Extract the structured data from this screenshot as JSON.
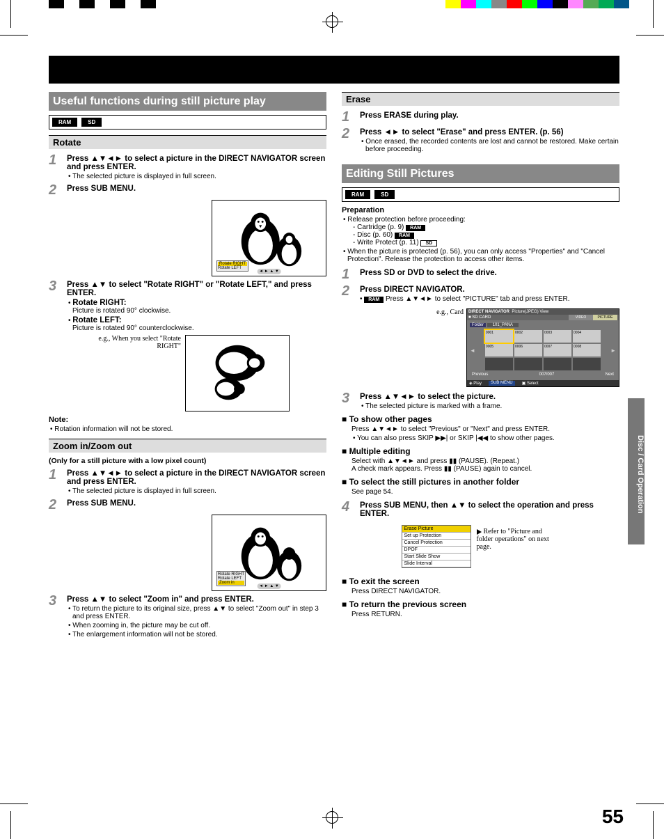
{
  "page_number": "55",
  "side_tab": "Disc / Card Operation",
  "left": {
    "h_main": "Useful functions during still picture play",
    "badges": [
      "RAM",
      "SD"
    ],
    "rotate": {
      "heading": "Rotate",
      "step1": "Press ▲▼◄► to select a picture in the DIRECT NAVIGATOR screen and press ENTER.",
      "step1_note": "The selected picture is displayed in full screen.",
      "step2": "Press SUB MENU.",
      "img_menu": [
        "Rotate RIGHT",
        "Rotate LEFT"
      ],
      "step3": "Press ▲▼ to select \"Rotate RIGHT\" or \"Rotate LEFT,\" and press ENTER.",
      "rr_label": "Rotate RIGHT:",
      "rr_text": "Picture is rotated 90° clockwise.",
      "rl_label": "Rotate LEFT:",
      "rl_text": "Picture is rotated 90° counterclockwise.",
      "eg": "e.g., When you select \"Rotate RIGHT\"",
      "note_hd": "Note:",
      "note_text": "Rotation information will not be stored."
    },
    "zoom": {
      "heading": "Zoom in/Zoom out",
      "pre": "(Only for a still picture with a low pixel count)",
      "step1": "Press ▲▼◄► to select a picture in the DIRECT NAVIGATOR screen and press ENTER.",
      "step1_note": "The selected picture is displayed in full screen.",
      "step2": "Press SUB MENU.",
      "img_menu": [
        "Rotate RIGHT",
        "Rotate LEFT",
        "Zoom in"
      ],
      "step3": "Press ▲▼ to select \"Zoom in\" and press ENTER.",
      "b1": "To return the picture to its original size, press ▲▼ to select \"Zoom out\" in step 3 and press ENTER.",
      "b2": "When zooming in, the picture may be cut off.",
      "b3": "The enlargement information will not be stored."
    }
  },
  "right": {
    "erase": {
      "heading": "Erase",
      "step1": "Press ERASE during play.",
      "step2": "Press ◄► to select \"Erase\" and press ENTER. (p. 56)",
      "note": "Once erased, the recorded contents are lost and cannot be restored. Make certain before proceeding."
    },
    "edit": {
      "h_main": "Editing Still Pictures",
      "badges": [
        "RAM",
        "SD"
      ],
      "prep_hd": "Preparation",
      "prep_b1": "Release protection before proceeding:",
      "prep_items": [
        {
          "text": "Cartridge (p. 9)",
          "badge": "RAM"
        },
        {
          "text": "Disc (p. 60)",
          "badge": "RAM"
        },
        {
          "text": "Write Protect (p. 11)",
          "badge": "SD"
        }
      ],
      "prep_b2": "When the picture is protected (p. 56), you can only access \"Properties\" and \"Cancel Protection\". Release the protection to access other items.",
      "step1": "Press SD or DVD to select the drive.",
      "step2": "Press DIRECT NAVIGATOR.",
      "step2_badge": "RAM",
      "step2_note": "Press ▲▼◄► to select \"PICTURE\" tab and press ENTER.",
      "eg": "e.g., Card",
      "nav": {
        "title": "DIRECT NAVIGATOR",
        "mode": "Picture(JPEG) View",
        "tabs": [
          "VIDEO",
          "PICTURE"
        ],
        "src": "SD CARD",
        "folder_label": "Folder",
        "folder": "101_PANA",
        "cells": [
          "0001",
          "0002",
          "0003",
          "0004",
          "0005",
          "0006",
          "0007",
          "0008"
        ],
        "prev": "Previous",
        "page": "007/007",
        "next": "Next",
        "foot1": "Play",
        "foot2": "SUB MENU",
        "foot3": "Select"
      },
      "step3": "Press ▲▼◄► to select the picture.",
      "step3_note": "The selected picture is marked with a frame.",
      "sec_pages": "To show other pages",
      "sec_pages_b1": "Press ▲▼◄► to select \"Previous\" or \"Next\" and press ENTER.",
      "sec_pages_b2": "You can also press SKIP ▶▶| or SKIP |◀◀ to show other pages.",
      "sec_multi": "Multiple editing",
      "sec_multi_b1": "Select with ▲▼◄► and press ▮▮ (PAUSE). (Repeat.)",
      "sec_multi_b2": "A check mark appears. Press ▮▮ (PAUSE) again to cancel.",
      "sec_folder": "To select the still pictures in another folder",
      "sec_folder_b": "See page 54.",
      "step4": "Press SUB MENU, then ▲▼ to select the operation and press ENTER.",
      "submenu": [
        "Erase Picture",
        "Set up Protection",
        "Cancel Protection",
        "DPOF",
        "Start Slide Show",
        "Slide Interval"
      ],
      "submenu_note": "Refer to \"Picture and folder operations\" on next page.",
      "sec_exit": "To exit the screen",
      "sec_exit_b": "Press DIRECT NAVIGATOR.",
      "sec_return": "To return the previous screen",
      "sec_return_b": "Press RETURN."
    }
  },
  "colors_left": [
    "#000",
    "#fff",
    "#000",
    "#fff",
    "#000",
    "#fff",
    "#000",
    "#fff"
  ],
  "colors_right": [
    "#ff0",
    "#f0f",
    "#0ff",
    "#888",
    "#f00",
    "#0f0",
    "#00f",
    "#000",
    "#f8f",
    "#5a5",
    "#0a5",
    "#058"
  ]
}
